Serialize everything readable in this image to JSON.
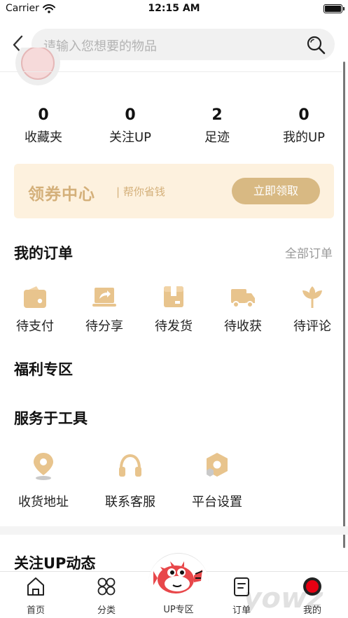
{
  "status_bar": {
    "carrier": "Carrier",
    "time": "12:15 AM",
    "battery_level": 1.0
  },
  "search": {
    "placeholder": "请输入您想要的物品"
  },
  "stats": [
    {
      "value": "0",
      "label": "收藏夹"
    },
    {
      "value": "0",
      "label": "关注UP"
    },
    {
      "value": "2",
      "label": "足迹"
    },
    {
      "value": "0",
      "label": "我的UP"
    }
  ],
  "coupon": {
    "title": "领券中心",
    "subtitle": "| 帮你省钱",
    "button": "立即领取"
  },
  "orders": {
    "title": "我的订单",
    "all_link": "全部订单",
    "items": [
      {
        "label": "待支付",
        "icon": "wallet-icon"
      },
      {
        "label": "待分享",
        "icon": "share-icon"
      },
      {
        "label": "待发货",
        "icon": "package-icon"
      },
      {
        "label": "待收获",
        "icon": "truck-icon"
      },
      {
        "label": "待评论",
        "icon": "flower-icon"
      }
    ]
  },
  "welfare": {
    "title": "福利专区"
  },
  "tools": {
    "title": "服务于工具",
    "items": [
      {
        "label": "收货地址",
        "icon": "location-icon"
      },
      {
        "label": "联系客服",
        "icon": "headphones-icon"
      },
      {
        "label": "平台设置",
        "icon": "settings-hex-icon"
      }
    ]
  },
  "follow_section": {
    "title": "关注UP动态"
  },
  "tab_bar": {
    "items": [
      {
        "label": "首页",
        "icon": "home-icon"
      },
      {
        "label": "分类",
        "icon": "category-icon"
      },
      {
        "label": "UP专区",
        "icon": "pufferfish-logo-icon"
      },
      {
        "label": "订单",
        "icon": "order-icon"
      },
      {
        "label": "我的",
        "icon": "profile-icon"
      }
    ]
  },
  "colors": {
    "accent_gold": "#d8b983",
    "coupon_bg": "#fdf1de",
    "icon_gold": "#e8c48d",
    "active_red": "#e60012"
  }
}
